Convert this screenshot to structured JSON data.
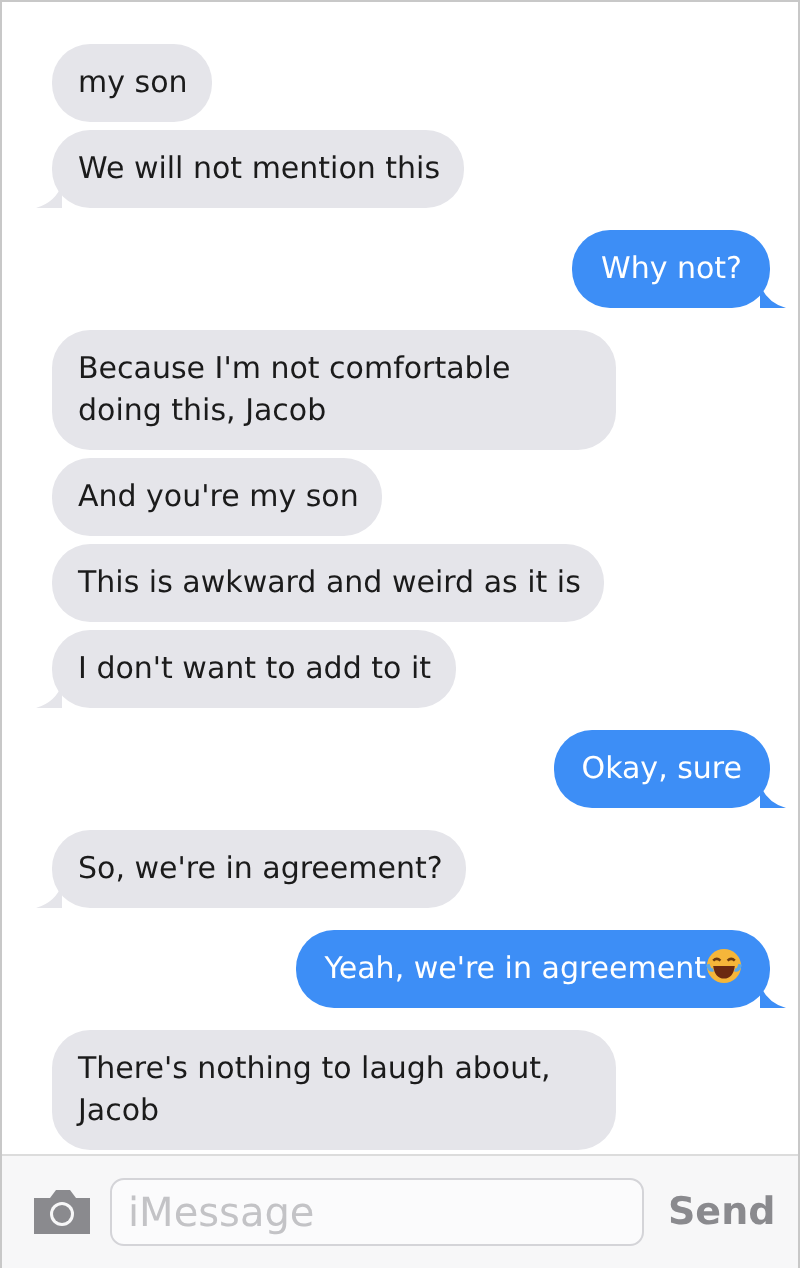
{
  "messages": [
    {
      "kind": "received",
      "text": "my son",
      "tail": false
    },
    {
      "kind": "received",
      "text": "We will not mention this",
      "tail": true
    },
    {
      "kind": "sent",
      "text": "Why not?",
      "tail": true
    },
    {
      "kind": "received",
      "text": "Because I'm not comfortable doing this, Jacob",
      "tail": false
    },
    {
      "kind": "received",
      "text": "And you're my son",
      "tail": false
    },
    {
      "kind": "received",
      "text": "This is awkward and weird as it is",
      "tail": false
    },
    {
      "kind": "received",
      "text": "I don't want to add to it",
      "tail": true
    },
    {
      "kind": "sent",
      "text": "Okay, sure",
      "tail": true
    },
    {
      "kind": "received",
      "text": "So, we're in agreement?",
      "tail": true
    },
    {
      "kind": "sent",
      "text": "Yeah, we're in agreement",
      "tail": true,
      "trailing_emoji": true
    },
    {
      "kind": "received",
      "text": "There's nothing to laugh about, Jacob",
      "tail": false
    }
  ],
  "composer": {
    "placeholder": "iMessage",
    "send": "Send"
  }
}
